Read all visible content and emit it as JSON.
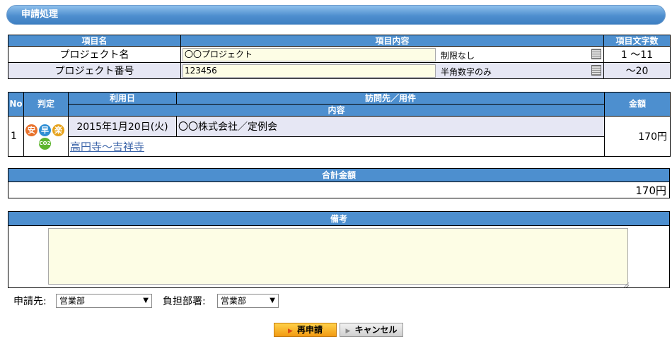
{
  "header": {
    "title": "申請処理"
  },
  "project_table": {
    "headers": [
      "項目名",
      "項目内容",
      "項目文字数"
    ],
    "rows": [
      {
        "label": "プロジェクト名",
        "value": "〇〇プロジェクト",
        "note": "制限なし",
        "length": "1 〜11"
      },
      {
        "label": "プロジェクト番号",
        "value": "123456",
        "note": "半角数字のみ",
        "length": "〜20"
      }
    ]
  },
  "trip_table": {
    "headers": {
      "no": "No",
      "judge": "判定",
      "date": "利用日",
      "dest": "訪問先／用件",
      "content": "内容",
      "amount": "金額"
    },
    "row": {
      "no": "1",
      "badges": [
        "安",
        "早",
        "楽",
        "CO2"
      ],
      "date": "2015年1月20日(火)",
      "destination": "〇〇株式会社／定例会",
      "route": "高円寺〜吉祥寺",
      "amount": "170円"
    }
  },
  "total": {
    "header": "合計金額",
    "value": "170円"
  },
  "memo": {
    "header": "備考",
    "value": ""
  },
  "applicant": {
    "label": "申請先:",
    "selected": "営業部"
  },
  "department": {
    "label": "負担部署:",
    "selected": "営業部"
  },
  "buttons": {
    "reapply": "再申請",
    "cancel": "キャンセル"
  },
  "colors": {
    "header_blue": "#4d8fcf",
    "row_alt": "#e6e7f4",
    "input_bg": "#fdfde5",
    "primary_button": "#f29a12"
  }
}
